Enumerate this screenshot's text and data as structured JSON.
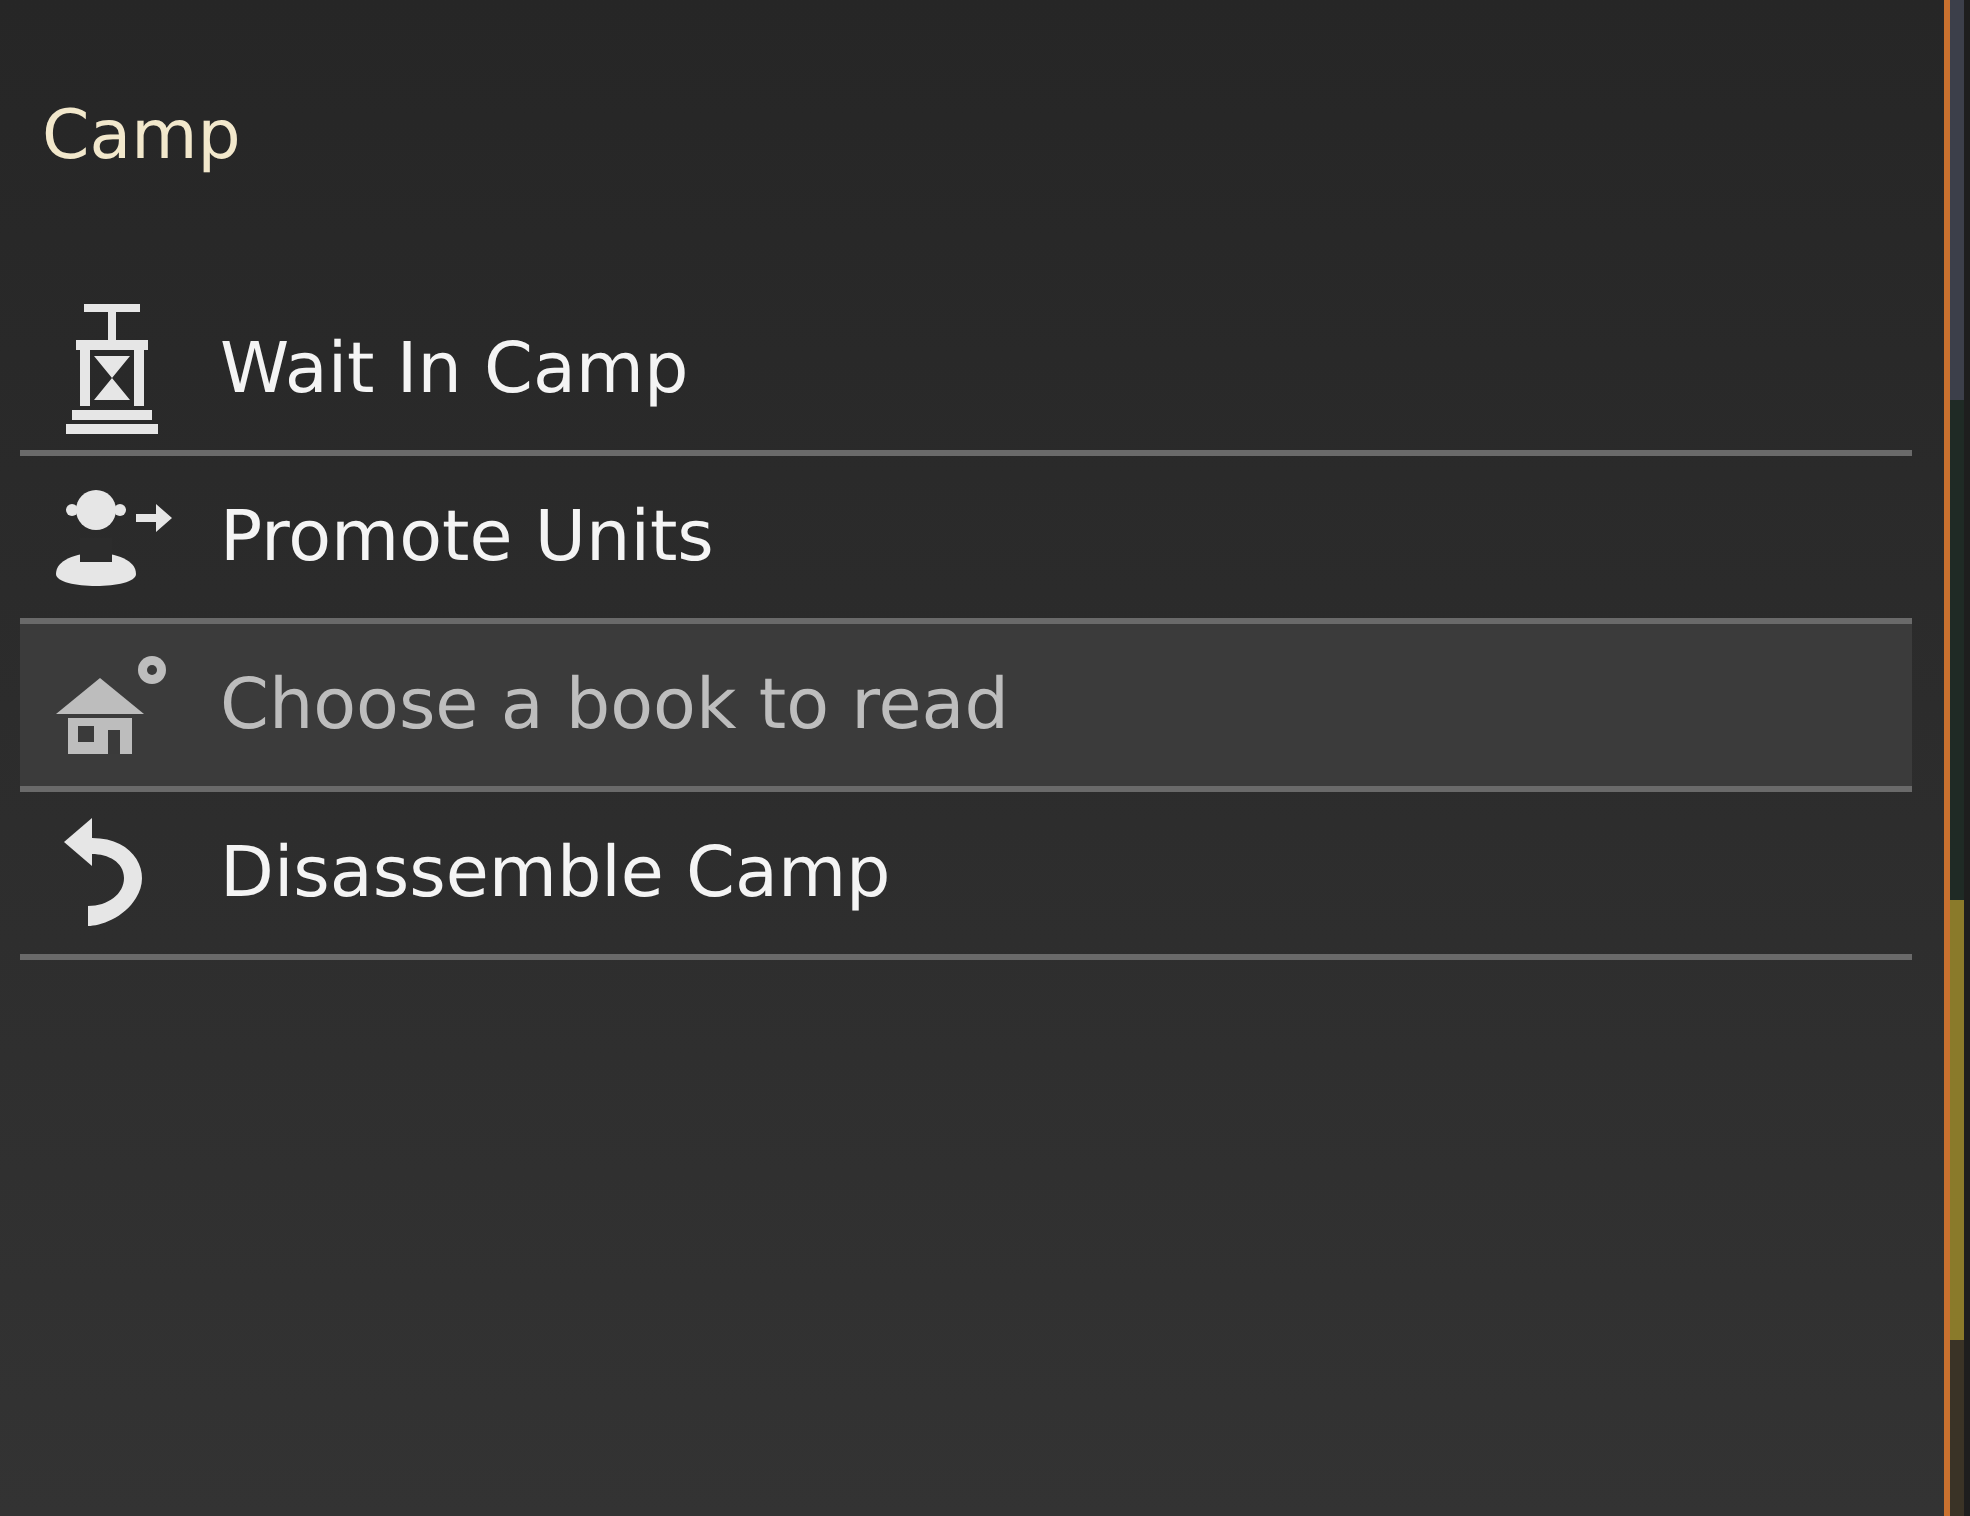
{
  "panel": {
    "title": "Camp"
  },
  "menu": [
    {
      "kind": "wait",
      "label": "Wait In Camp",
      "selected": false,
      "disabled": false
    },
    {
      "kind": "promote",
      "label": "Promote Units",
      "selected": false,
      "disabled": false
    },
    {
      "kind": "book",
      "label": "Choose a book to read",
      "selected": true,
      "disabled": true
    },
    {
      "kind": "disassemble",
      "label": "Disassemble Camp",
      "selected": false,
      "disabled": false
    }
  ]
}
